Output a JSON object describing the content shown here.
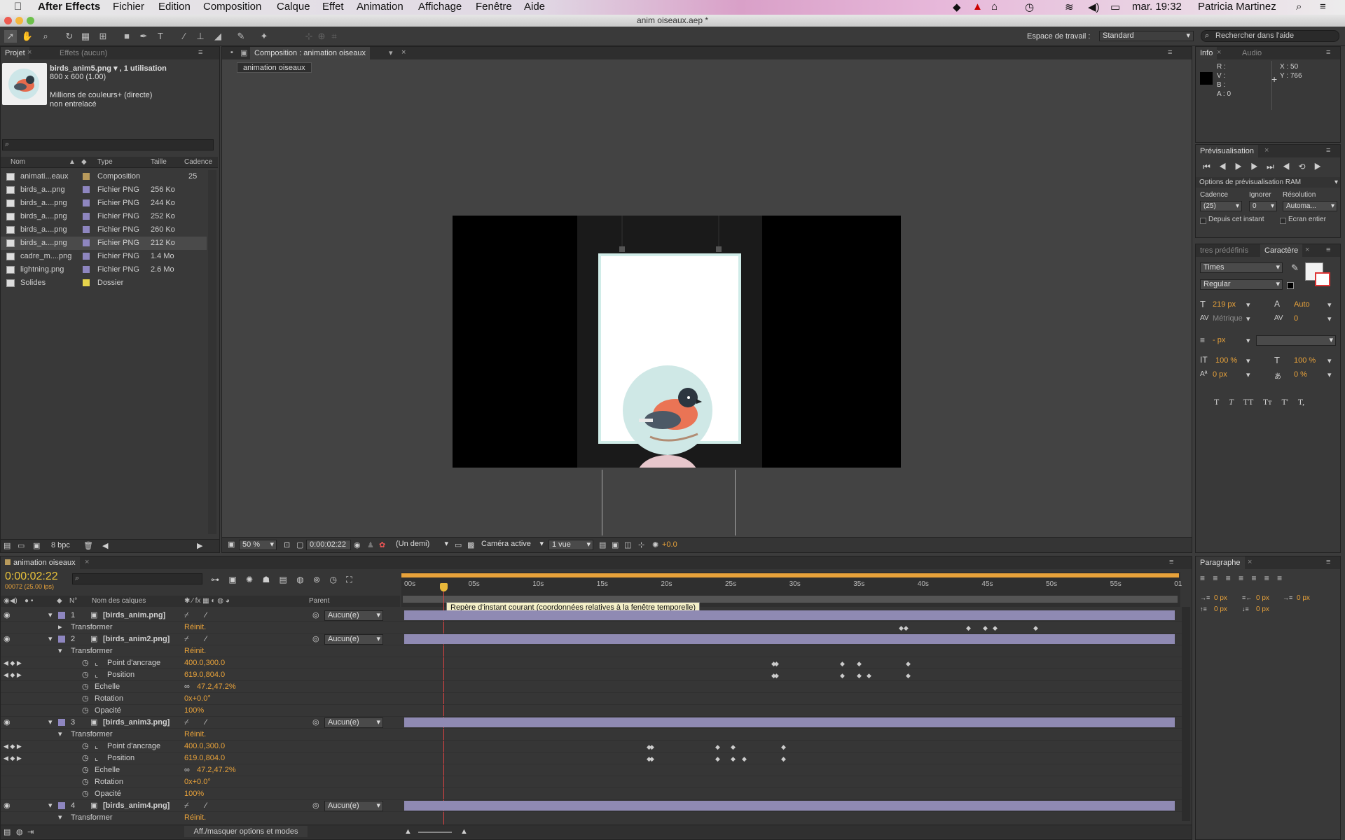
{
  "menubar": {
    "apple": "",
    "app": "After Effects",
    "items": [
      "Fichier",
      "Edition",
      "Composition",
      "Calque",
      "Effet",
      "Animation",
      "Affichage",
      "Fenêtre",
      "Aide"
    ],
    "time": "mar. 19:32",
    "user": "Patricia Martinez"
  },
  "window": {
    "title": "anim oiseaux.aep *"
  },
  "workspace": {
    "label": "Espace de travail :",
    "value": "Standard",
    "search_placeholder": "Rechercher dans l'aide"
  },
  "project": {
    "tab": "Projet",
    "tab2": "Effets (aucun)",
    "asset_name": "birds_anim5.png ▾ , 1 utilisation",
    "asset_size": "800 x 600 (1.00)",
    "asset_color": "Millions de couleurs+ (directe)",
    "asset_scan": "non entrelacé",
    "columns": [
      "Nom",
      "Type",
      "Taille",
      "Cadence"
    ],
    "items": [
      {
        "name": "animati...eaux",
        "type": "Composition",
        "size": "",
        "rate": "25",
        "color": "#b89a5c"
      },
      {
        "name": "birds_a...png",
        "type": "Fichier PNG",
        "size": "256 Ko",
        "rate": "",
        "color": "#8e86c0"
      },
      {
        "name": "birds_a....png",
        "type": "Fichier PNG",
        "size": "244 Ko",
        "rate": "",
        "color": "#8e86c0"
      },
      {
        "name": "birds_a....png",
        "type": "Fichier PNG",
        "size": "252 Ko",
        "rate": "",
        "color": "#8e86c0"
      },
      {
        "name": "birds_a....png",
        "type": "Fichier PNG",
        "size": "260 Ko",
        "rate": "",
        "color": "#8e86c0"
      },
      {
        "name": "birds_a....png",
        "type": "Fichier PNG",
        "size": "212 Ko",
        "rate": "",
        "color": "#8e86c0"
      },
      {
        "name": "cadre_m....png",
        "type": "Fichier PNG",
        "size": "1.4 Mo",
        "rate": "",
        "color": "#8e86c0"
      },
      {
        "name": "lightning.png",
        "type": "Fichier PNG",
        "size": "2.6 Mo",
        "rate": "",
        "color": "#8e86c0"
      },
      {
        "name": "Solides",
        "type": "Dossier",
        "size": "",
        "rate": "",
        "color": "#e6d44c"
      }
    ],
    "bpc": "8 bpc"
  },
  "comp": {
    "tab": "Composition : animation oiseaux",
    "chip": "animation oiseaux",
    "zoom": "50 %",
    "timecode": "0:00:02:22",
    "resolution": "(Un demi)",
    "camera": "Caméra active",
    "views": "1 vue",
    "exposure": "+0.0"
  },
  "info": {
    "tab": "Info",
    "tab2": "Audio",
    "r": "R :",
    "v": "V :",
    "b": "B :",
    "a": "A : 0",
    "x": "X : 50",
    "y": "Y : 766"
  },
  "preview": {
    "tab": "Prévisualisation",
    "ram": "Options de prévisualisation RAM",
    "cadence_label": "Cadence",
    "ignorer_label": "Ignorer",
    "resolution_label": "Résolution",
    "cadence": "(25)",
    "ignorer": "0",
    "resolution": "Automa...",
    "from_now": "Depuis cet instant",
    "fullscreen": "Ecran entier"
  },
  "character": {
    "tab_prev": "tres prédéfinis",
    "tab": "Caractère",
    "font": "Times",
    "style": "Regular",
    "size": "219 px",
    "leading": "Auto",
    "kerning": "Métrique",
    "tracking": "0",
    "stroke": "- px",
    "vscale": "100 %",
    "hscale": "100 %",
    "baseline": "0 px",
    "tsume": "0 %",
    "styles": [
      "T",
      "T",
      "TT",
      "Tт",
      "T'",
      "T,"
    ]
  },
  "paragraph": {
    "tab": "Paragraphe",
    "indent1": "0 px",
    "indent2": "0 px",
    "indent3": "0 px",
    "space1": "0 px",
    "space2": "0 px"
  },
  "timeline": {
    "tab": "animation oiseaux",
    "timecode": "0:00:02:22",
    "frames": "00072 (25.00 ips)",
    "col_num": "N°",
    "col_name": "Nom des calques",
    "col_parent": "Parent",
    "ticks": [
      "00s",
      "05s",
      "10s",
      "15s",
      "20s",
      "25s",
      "30s",
      "35s",
      "40s",
      "45s",
      "50s",
      "55s",
      "01"
    ],
    "tooltip": "Repère d'instant courant (coordonnées relatives à la fenêtre temporelle)",
    "toggle": "Aff./masquer options et modes",
    "layers": [
      {
        "num": "1",
        "name": "[birds_anim.png]",
        "parent": "Aucun(e)"
      },
      {
        "num": "2",
        "name": "[birds_anim2.png]",
        "parent": "Aucun(e)"
      },
      {
        "num": "3",
        "name": "[birds_anim3.png]",
        "parent": "Aucun(e)"
      },
      {
        "num": "4",
        "name": "[birds_anim4.png]",
        "parent": "Aucun(e)"
      }
    ],
    "transform": "Transformer",
    "reinit": "Réinit.",
    "props": {
      "anchor": "Point d'ancrage",
      "position": "Position",
      "scale": "Echelle",
      "rotation": "Rotation",
      "opacity": "Opacité"
    },
    "l2": {
      "anchor": "400.0,300.0",
      "position": "619.0,804.0",
      "scale": "47.2,47.2%",
      "rotation": "0x+0.0°",
      "opacity": "100%"
    },
    "l3": {
      "anchor": "400.0,300.0",
      "position": "619.0,804.0",
      "scale": "47.2,47.2%",
      "rotation": "0x+0.0°",
      "opacity": "100%"
    }
  }
}
